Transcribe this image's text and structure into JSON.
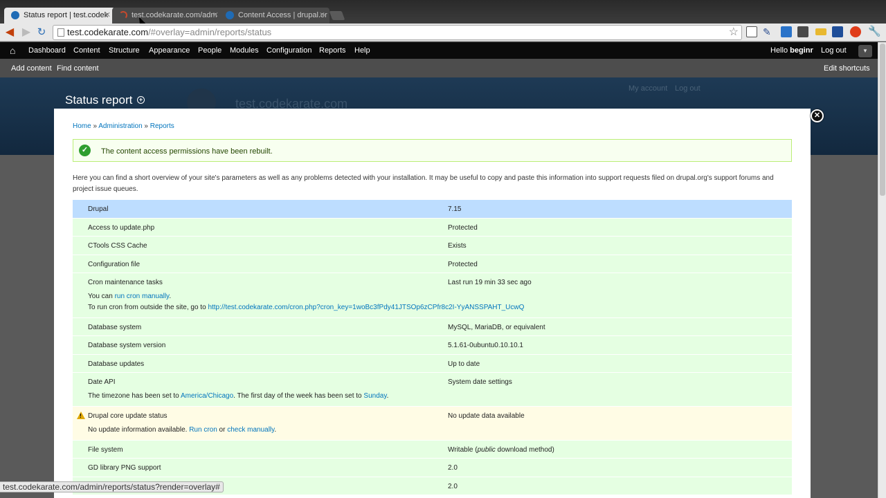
{
  "browser": {
    "tabs": [
      {
        "label": "Status report | test.codek",
        "active": true
      },
      {
        "label": "test.codekarate.com/adm",
        "active": false
      },
      {
        "label": "Content Access | drupal.or",
        "active": false
      }
    ],
    "url_host": "test.codekarate.com",
    "url_path": "/#overlay=admin/reports/status",
    "status_url": "test.codekarate.com/admin/reports/status?render=overlay#"
  },
  "admin_toolbar": {
    "items": [
      "Dashboard",
      "Content",
      "Structure",
      "Appearance",
      "People",
      "Modules",
      "Configuration",
      "Reports",
      "Help"
    ],
    "hello": "Hello ",
    "user": "beginr",
    "logout": "Log out"
  },
  "shortcuts": {
    "add_content": "Add content",
    "find_content": "Find content",
    "edit_shortcuts": "Edit shortcuts"
  },
  "site": {
    "name": "test.codekarate.com",
    "my_account": "My account",
    "log_out": "Log out"
  },
  "overlay": {
    "title": "Status report",
    "breadcrumb": [
      "Home",
      "Administration",
      "Reports"
    ],
    "message": "The content access permissions have been rebuilt.",
    "intro": "Here you can find a short overview of your site's parameters as well as any problems detected with your installation. It may be useful to copy and paste this information into support requests filed on drupal.org's support forums and project issue queues."
  },
  "status_rows": [
    {
      "title": "Drupal",
      "value": "7.15",
      "severity": "info"
    },
    {
      "title": "Access to update.php",
      "value": "Protected",
      "severity": "ok"
    },
    {
      "title": "CTools CSS Cache",
      "value": "Exists",
      "severity": "ok"
    },
    {
      "title": "Configuration file",
      "value": "Protected",
      "severity": "ok"
    },
    {
      "title": "Cron maintenance tasks",
      "value": "Last run 19 min 33 sec ago",
      "severity": "ok",
      "desc_1_pre": "You can ",
      "desc_1_link": "run cron manually",
      "desc_1_post": ".",
      "desc_2_pre": "To run cron from outside the site, go to ",
      "desc_2_link": "http://test.codekarate.com/cron.php?cron_key=1woBc3fPdy41JTSOp6zCPfr8c2I-YyANSSPAHT_UcwQ"
    },
    {
      "title": "Database system",
      "value": "MySQL, MariaDB, or equivalent",
      "severity": "ok"
    },
    {
      "title": "Database system version",
      "value": "5.1.61-0ubuntu0.10.10.1",
      "severity": "ok"
    },
    {
      "title": "Database updates",
      "value": "Up to date",
      "severity": "ok"
    },
    {
      "title": "Date API",
      "value": "System date settings",
      "severity": "ok",
      "desc_pre": "The timezone has been set to ",
      "desc_link_1": "America/Chicago",
      "desc_mid": ". The first day of the week has been set to ",
      "desc_link_2": "Sunday",
      "desc_post": "."
    },
    {
      "title": "Drupal core update status",
      "value": "No update data available",
      "severity": "warning",
      "desc_pre": "No update information available. ",
      "desc_link_1": "Run cron",
      "desc_mid": " or ",
      "desc_link_2": "check manually",
      "desc_post": "."
    },
    {
      "title": "File system",
      "value_pre": "Writable (",
      "value_em": "public",
      "value_post": " download method)",
      "severity": "ok"
    },
    {
      "title": "GD library PNG support",
      "value": "2.0",
      "severity": "ok"
    },
    {
      "title": "",
      "value": "2.0",
      "severity": "ok"
    }
  ]
}
